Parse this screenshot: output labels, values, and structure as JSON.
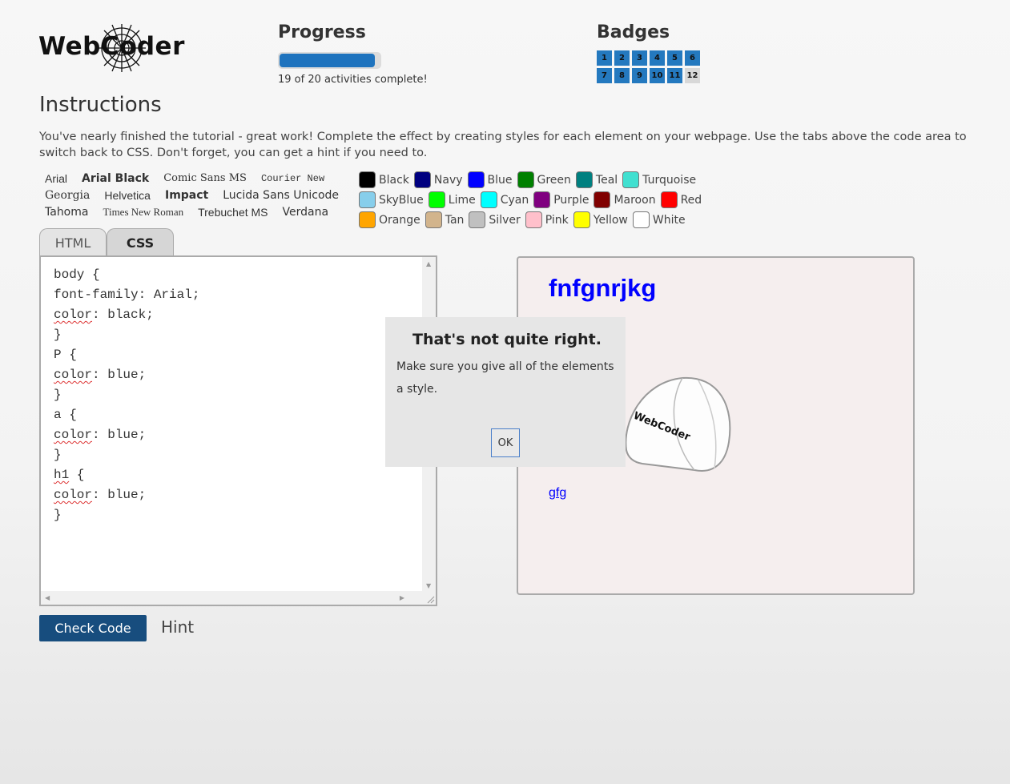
{
  "logo": {
    "text": "WebCoder"
  },
  "progress": {
    "title": "Progress",
    "completed": 19,
    "total": 20,
    "fraction": 0.95,
    "status_text": "19 of 20 activities complete!"
  },
  "badges": {
    "title": "Badges",
    "items": [
      {
        "label": "1",
        "earned": true
      },
      {
        "label": "2",
        "earned": true
      },
      {
        "label": "3",
        "earned": true
      },
      {
        "label": "4",
        "earned": true
      },
      {
        "label": "5",
        "earned": true
      },
      {
        "label": "6",
        "earned": true
      },
      {
        "label": "7",
        "earned": true
      },
      {
        "label": "8",
        "earned": true
      },
      {
        "label": "9",
        "earned": true
      },
      {
        "label": "10",
        "earned": true
      },
      {
        "label": "11",
        "earned": true
      },
      {
        "label": "12",
        "earned": false
      }
    ]
  },
  "instructions": {
    "title": "Instructions",
    "text": "You've nearly finished the tutorial - great work! Complete the effect by creating styles for each element on your webpage. Use the tabs above the code area to switch back to CSS. Don't forget, you can get a hint if you need to."
  },
  "fonts": {
    "rows": [
      [
        "Arial",
        "Arial Black",
        "Comic Sans MS",
        "Courier New"
      ],
      [
        "Georgia",
        "Helvetica",
        "Impact",
        "Lucida Sans Unicode"
      ],
      [
        "Tahoma",
        "Times New Roman",
        "Trebuchet MS",
        "Verdana"
      ]
    ]
  },
  "colors": {
    "rows": [
      [
        {
          "name": "Black",
          "hex": "#000000"
        },
        {
          "name": "Navy",
          "hex": "#000080"
        },
        {
          "name": "Blue",
          "hex": "#0000ff"
        },
        {
          "name": "Green",
          "hex": "#008000"
        },
        {
          "name": "Teal",
          "hex": "#008080"
        },
        {
          "name": "Turquoise",
          "hex": "#40e0d0"
        }
      ],
      [
        {
          "name": "SkyBlue",
          "hex": "#87ceeb"
        },
        {
          "name": "Lime",
          "hex": "#00ff00"
        },
        {
          "name": "Cyan",
          "hex": "#00ffff"
        },
        {
          "name": "Purple",
          "hex": "#800080"
        },
        {
          "name": "Maroon",
          "hex": "#800000"
        },
        {
          "name": "Red",
          "hex": "#ff0000"
        }
      ],
      [
        {
          "name": "Orange",
          "hex": "#ffa500"
        },
        {
          "name": "Tan",
          "hex": "#d2b48c"
        },
        {
          "name": "Silver",
          "hex": "#c0c0c0"
        },
        {
          "name": "Pink",
          "hex": "#ffc0cb"
        },
        {
          "name": "Yellow",
          "hex": "#ffff00"
        },
        {
          "name": "White",
          "hex": "#ffffff"
        }
      ]
    ]
  },
  "tabs": [
    {
      "label": "HTML",
      "active": false
    },
    {
      "label": "CSS",
      "active": true
    }
  ],
  "editor": {
    "lines": [
      {
        "text": "body {",
        "prop": ""
      },
      {
        "text": "font-family: Arial;",
        "prop": ""
      },
      {
        "text": ": black;",
        "prop": "color"
      },
      {
        "text": "}",
        "prop": ""
      },
      {
        "text": "P {",
        "prop": ""
      },
      {
        "text": ": blue;",
        "prop": "color"
      },
      {
        "text": "}",
        "prop": ""
      },
      {
        "text": "a {",
        "prop": ""
      },
      {
        "text": ": blue;",
        "prop": "color"
      },
      {
        "text": "}",
        "prop": ""
      },
      {
        "text": " {",
        "prop": "h1"
      },
      {
        "text": ": blue;",
        "prop": "color"
      },
      {
        "text": "}",
        "prop": ""
      }
    ]
  },
  "preview": {
    "heading": "fnfgnrjkg",
    "link": "gfg",
    "cap_logo_text": "WebCoder"
  },
  "buttons": {
    "check_code": "Check Code",
    "hint": "Hint"
  },
  "dialog": {
    "title": "That's not quite right.",
    "message": "Make sure you give all of the elements a style.",
    "ok": "OK"
  }
}
